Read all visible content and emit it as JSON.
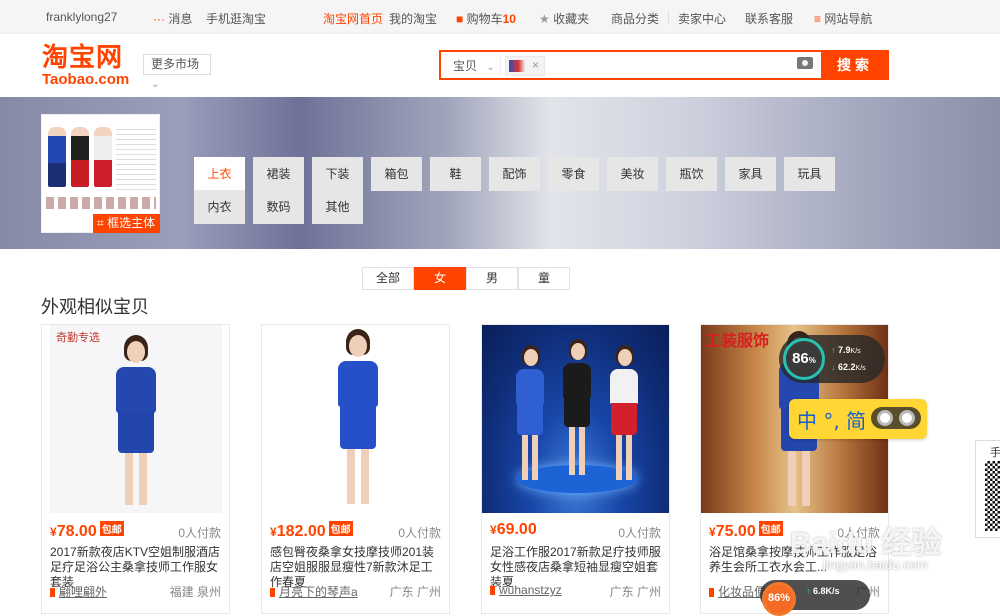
{
  "topbar": {
    "username": "franklylong27",
    "messages": "消息",
    "mobile": "手机逛淘宝",
    "home": "淘宝网首页",
    "my_taobao": "我的淘宝",
    "cart": "购物车",
    "cart_count": "10",
    "favorites": "收藏夹",
    "categories": "商品分类",
    "seller_center": "卖家中心",
    "contact": "联系客服",
    "site_nav": "网站导航"
  },
  "logo": {
    "cn": "淘宝网",
    "en": "Taobao.com"
  },
  "market_button": "更多市场",
  "search": {
    "category": "宝贝",
    "button": "搜索",
    "clear": "×"
  },
  "banner": {
    "select_subject": "框选主体",
    "tabs_row1": [
      "上衣",
      "裙装",
      "下装",
      "箱包",
      "鞋",
      "配饰",
      "零食",
      "美妆",
      "瓶饮",
      "家具",
      "玩具"
    ],
    "tabs_row2": [
      "内衣",
      "数码",
      "其他"
    ]
  },
  "gender_filters": [
    "全部",
    "女",
    "男",
    "童"
  ],
  "section_title": "外观相似宝贝",
  "products": [
    {
      "currency": "¥",
      "price": "78.00",
      "tag": "包邮",
      "sold": "0人付款",
      "title": "2017新款夜店KTV空姐制服酒店足疗足浴公主桑拿技师工作服女套装",
      "shop": "翩哩翩外",
      "location": "福建 泉州",
      "watermark": "奇勤专选"
    },
    {
      "currency": "¥",
      "price": "182.00",
      "tag": "包邮",
      "sold": "0人付款",
      "title": "感包臀夜桑拿女技摩技师201装店空姐服服显瘦性7新款沐足工作春夏",
      "shop": "月亮下的琴声a",
      "location": "广东 广州"
    },
    {
      "currency": "¥",
      "price": "69.00",
      "sold": "0人付款",
      "title": "足浴工作服2017新款足疗技师服女性感夜店桑拿短袖显瘦空姐套装夏",
      "shop": "wuhanstzyz",
      "location": "广东 广州"
    },
    {
      "currency": "¥",
      "price": "75.00",
      "tag": "包邮",
      "sold": "0人付款",
      "title": "浴足馆桑拿按摩技师工作服足浴养生会所工衣水会工...",
      "shop": "化妆品便",
      "location": "广州",
      "watermark": "工装服饰"
    }
  ],
  "speed_widget": {
    "percent": "86",
    "unit": "%",
    "up": "7.9",
    "down": "62.2",
    "rate_unit": "K/s"
  },
  "ime": {
    "text": "中 °, 简"
  },
  "qr_label": "手",
  "baidu_watermark": {
    "main": "Baidu 经验",
    "sub": "jingyan.baidu.com"
  },
  "bottom_widget": {
    "percent": "86",
    "unit": "%",
    "up": "6.8",
    "rate_unit": "K/s"
  }
}
